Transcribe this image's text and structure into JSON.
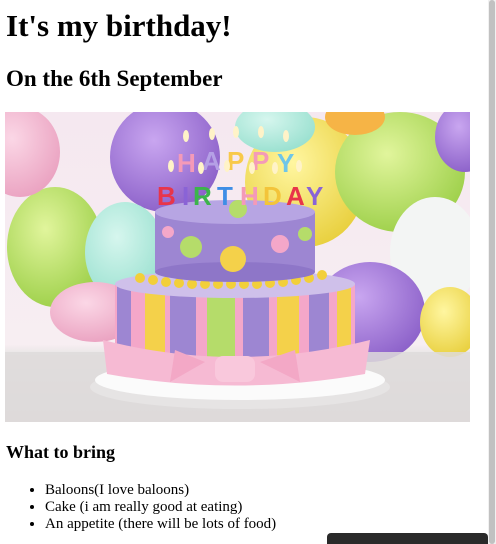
{
  "page": {
    "title": "It's my birthday!",
    "subtitle": "On the 6th September"
  },
  "hero_image": {
    "candle_letters_top": [
      "H",
      "A",
      "P",
      "P",
      "Y"
    ],
    "candle_letters_bottom": [
      "B",
      "I",
      "R",
      "T",
      "H",
      "D",
      "A",
      "Y"
    ],
    "colors": {
      "balloon_purple": "#a77ed8",
      "balloon_green": "#b5e06a",
      "balloon_yellow": "#f2e26a",
      "cake_purple": "#9d86d2",
      "cake_pink": "#f4a7c9",
      "ribbon_pink": "#f6bad3",
      "plate": "#f3f3f3"
    }
  },
  "bring_section": {
    "heading": "What to bring",
    "items": [
      "Baloons(I love baloons)",
      "Cake (i am really good at eating)",
      "An appetite (there will be lots of food)"
    ]
  }
}
